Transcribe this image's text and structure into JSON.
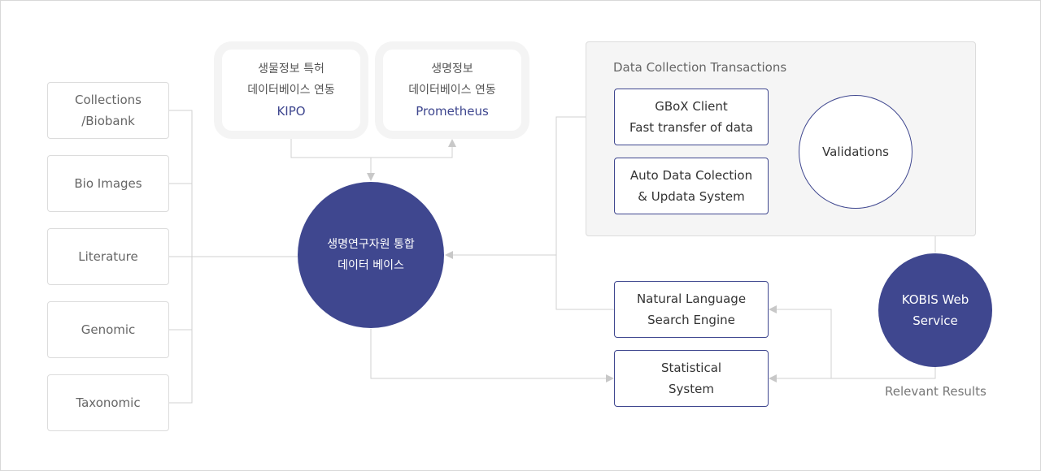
{
  "colors": {
    "accent": "#3f478f",
    "connector": "#cccccc",
    "panel_bg": "#f5f5f5",
    "box_border": "#dcdcdc"
  },
  "sources": [
    {
      "lines": [
        "Collections",
        "/Biobank"
      ]
    },
    {
      "lines": [
        "Bio Images"
      ]
    },
    {
      "lines": [
        "Literature"
      ]
    },
    {
      "lines": [
        "Genomic"
      ]
    },
    {
      "lines": [
        "Taxonomic"
      ]
    }
  ],
  "external": [
    {
      "line1": "생물정보 특허",
      "line2": "데이터베이스 연동",
      "name": "KIPO"
    },
    {
      "line1": "생명정보",
      "line2": "데이터베이스 연동",
      "name": "Prometheus"
    }
  ],
  "hub": {
    "line1": "생명연구자원 통합",
    "line2": "데이터 베이스"
  },
  "panel": {
    "title": "Data Collection Transactions",
    "nodes": [
      {
        "line1": "GBoX Client",
        "line2": "Fast transfer of data"
      },
      {
        "line1": "Auto Data Colection",
        "line2": "& Updata System"
      }
    ],
    "validations": "Validations"
  },
  "services": [
    {
      "line1": "Natural Language",
      "line2": "Search Engine"
    },
    {
      "line1": "Statistical",
      "line2": "System"
    }
  ],
  "kobis": {
    "line1": "KOBIS Web",
    "line2": "Service"
  },
  "caption": "Relevant Results"
}
